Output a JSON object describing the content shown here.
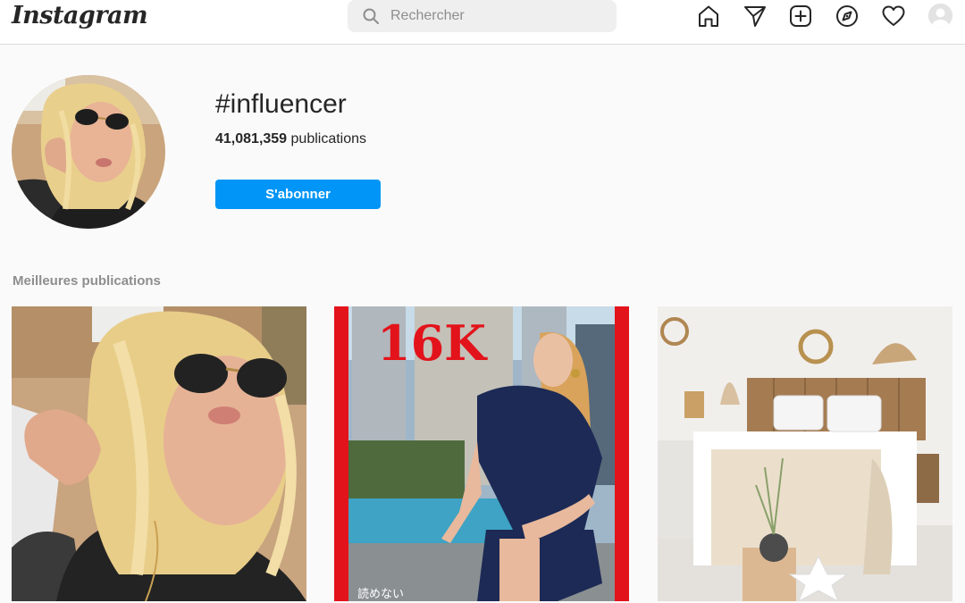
{
  "app": {
    "logo_text": "Instagram"
  },
  "search": {
    "placeholder": "Rechercher",
    "value": ""
  },
  "nav": {
    "icons": [
      "home-icon",
      "direct-message-icon",
      "new-post-icon",
      "explore-icon",
      "activity-heart-icon",
      "profile-avatar"
    ]
  },
  "hashtag": {
    "title": "#influencer",
    "count": "41,081,359",
    "count_label": "publications",
    "follow_label": "S'abonner"
  },
  "top_posts": {
    "title": "Meilleures publications",
    "posts": [
      {
        "overlay_text": ""
      },
      {
        "overlay_text": "16K",
        "caption": "読めない"
      },
      {
        "overlay_text": ""
      }
    ]
  },
  "colors": {
    "accent": "#0095f6",
    "border": "#dbdbdb",
    "background": "#fafafa",
    "muted_text": "#8e8e8e",
    "post2_frame": "#e3131b"
  }
}
